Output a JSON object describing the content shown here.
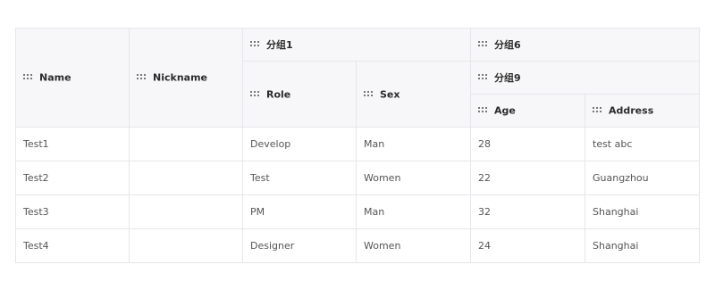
{
  "columns": {
    "name": "Name",
    "nickname": "Nickname",
    "group1": "分组1",
    "role": "Role",
    "sex": "Sex",
    "group6": "分组6",
    "group9": "分组9",
    "age": "Age",
    "address": "Address"
  },
  "icons": {
    "drag_handle": "drag-handle-icon"
  },
  "rows": [
    {
      "name": "Test1",
      "nickname": "",
      "role": "Develop",
      "sex": "Man",
      "age": "28",
      "address": "test abc"
    },
    {
      "name": "Test2",
      "nickname": "",
      "role": "Test",
      "sex": "Women",
      "age": "22",
      "address": "Guangzhou"
    },
    {
      "name": "Test3",
      "nickname": "",
      "role": "PM",
      "sex": "Man",
      "age": "32",
      "address": "Shanghai"
    },
    {
      "name": "Test4",
      "nickname": "",
      "role": "Designer",
      "sex": "Women",
      "age": "24",
      "address": "Shanghai"
    }
  ]
}
